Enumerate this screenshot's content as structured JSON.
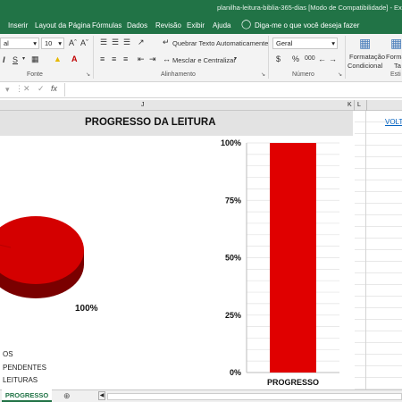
{
  "title_bar": {
    "text": "planilha-leitura-biblia-365-dias  [Modo de Compatibilidade]  -  Exce"
  },
  "menu": {
    "items": [
      "Inserir",
      "Layout da Página",
      "Fórmulas",
      "Dados",
      "Revisão",
      "Exibir",
      "Ajuda"
    ],
    "tell_me": "Diga-me o que você deseja fazer"
  },
  "ribbon": {
    "font_name": "al",
    "font_size": "10",
    "wrap_text": "Quebrar Texto Automaticamente",
    "merge_center": "Mesclar e Centralizar",
    "number_format": "Geral",
    "conditional_format_line1": "Formatação",
    "conditional_format_line2": "Condicional",
    "format_table_line1": "Forma",
    "format_table_line2": "Ta",
    "groups": {
      "font": "Fonte",
      "alignment": "Alinhamento",
      "number": "Número",
      "styles": "Esti"
    },
    "percent": "%",
    "currency": "$",
    "thousands": "000"
  },
  "columns": {
    "j": "J",
    "k": "K",
    "l": "L"
  },
  "sheet": {
    "title": "PROGRESSO DA LEITURA",
    "link_text": "VOLT",
    "pie_label": "100%",
    "legend": [
      "OS",
      "PENDENTES",
      "LEITURAS"
    ]
  },
  "chart_data": [
    {
      "type": "pie",
      "labels": [
        "LIDOS"
      ],
      "values": [
        100
      ],
      "data_labels": [
        "100%"
      ],
      "colors": [
        "#d40000"
      ]
    },
    {
      "type": "bar",
      "categories": [
        "PROGRESSO"
      ],
      "values": [
        100
      ],
      "ylim": [
        0,
        100
      ],
      "yticks": [
        "0%",
        "25%",
        "50%",
        "75%",
        "100%"
      ],
      "colors": [
        "#e00000"
      ]
    }
  ],
  "tabs": {
    "active": "PROGRESSO"
  }
}
